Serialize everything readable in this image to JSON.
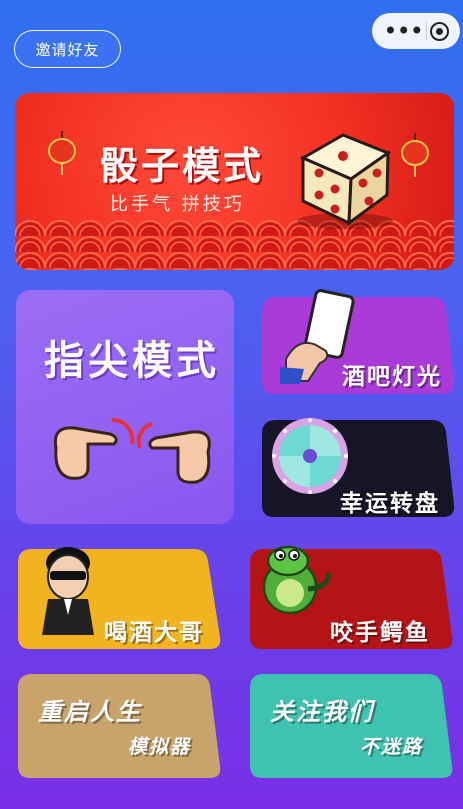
{
  "header": {
    "invite_label": "邀请好友"
  },
  "capsule": {
    "menu_icon": "more-dots-icon",
    "close_icon": "target-circle-icon"
  },
  "banner": {
    "title": "骰子模式",
    "subtitle": "比手气 拼技巧"
  },
  "cards": {
    "finger": {
      "title": "指尖模式"
    },
    "bar_light": {
      "title": "酒吧灯光"
    },
    "lucky_wheel": {
      "title": "幸运转盘"
    },
    "drink_boss": {
      "title": "喝酒大哥"
    },
    "croc": {
      "title": "咬手鳄鱼"
    },
    "restart": {
      "title": "重启人生",
      "subtitle": "模拟器"
    },
    "follow": {
      "title": "关注我们",
      "subtitle": "不迷路"
    }
  },
  "colors": {
    "bg_top": "#2f6ff2",
    "bg_bottom": "#7a2fe6",
    "banner_red": "#f23022",
    "finger_purple": "#8a57f0",
    "bar_purple": "#a93bd8",
    "wheel_black": "#151525",
    "boss_yellow": "#f2b321",
    "croc_red": "#b41416",
    "restart_tan": "#c9a36c",
    "follow_teal": "#3fc3b0"
  }
}
